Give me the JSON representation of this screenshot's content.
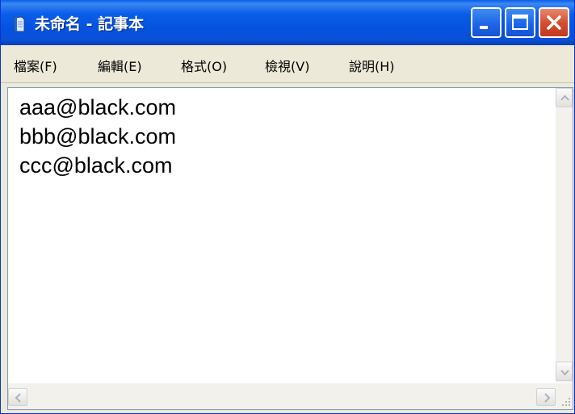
{
  "window": {
    "title": "未命名 - 記事本",
    "icon": "notepad-icon",
    "controls": {
      "minimize": "minimize-icon",
      "maximize": "maximize-icon",
      "close": "close-icon"
    }
  },
  "menu": {
    "items": [
      {
        "label": "檔案(F)"
      },
      {
        "label": "編輯(E)"
      },
      {
        "label": "格式(O)"
      },
      {
        "label": "檢視(V)"
      },
      {
        "label": "說明(H)"
      }
    ]
  },
  "editor": {
    "lines": [
      "aaa@black.com",
      "bbb@black.com",
      "ccc@black.com"
    ]
  },
  "colors": {
    "titlebar": "#0a5ee8",
    "close_button": "#d6502f",
    "menu_background": "#ece9d8",
    "editor_background": "#ffffff"
  }
}
